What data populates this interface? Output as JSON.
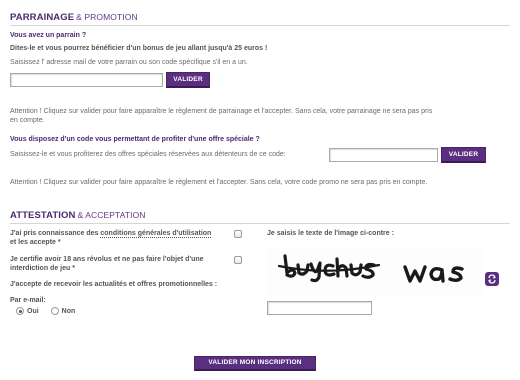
{
  "parrainage": {
    "title": "PARRAINAGE",
    "title_sub": "& PROMOTION",
    "question": "Vous avez un parrain ?",
    "bonus_text": "Dites-le et vous pourrez bénéficier d'un bonus de jeu allant jusqu'à 25 euros !",
    "instruction": "Saisissez l' adresse mail de votre parrain ou son code spécifique s'il en a un.",
    "input_value": "",
    "button_label": "VALIDER",
    "warning_line1": "Attention ! Cliquez sur valider pour faire apparaître le règlement de parrainage et l'accepter. Sans cela, votre parrainage ne sera pas pris",
    "warning_line2": "en compte."
  },
  "promo": {
    "question": "Vous disposez d'un code vous permettant de profiter d'une offre spéciale ?",
    "instruction": "Saisissez-le et vous profiterez des offres spéciales réservées aux détenteurs de ce code:",
    "input_value": "",
    "button_label": "VALIDER",
    "warning": "Attention ! Cliquez sur valider pour faire apparaître le règlement et l'accepter. Sans cela, votre code promo ne sera pas pris en compte."
  },
  "attestation": {
    "title": "ATTESTATION",
    "title_sub": "& ACCEPTATION",
    "cgu_prefix": "J'ai pris connaissance des ",
    "cgu_link": "conditions générales d'utilisation",
    "cgu_suffix": "et les accepte *",
    "age_line1": "Je certifie avoir 18 ans révolus et ne pas faire l'objet d'une",
    "age_line2": "interdiction de jeu *",
    "news_label": "J'accepte de recevoir les actualités et offres promotionnelles :",
    "email_label": "Par e-mail:",
    "radio_yes": "Oui",
    "radio_no": "Non",
    "captcha_label": "Je saisis le texte de l'image ci-contre :",
    "captcha_word1": "buychus",
    "captcha_word2": "was",
    "captcha_input_value": "",
    "submit_label": "VALIDER MON INSCRIPTION"
  }
}
